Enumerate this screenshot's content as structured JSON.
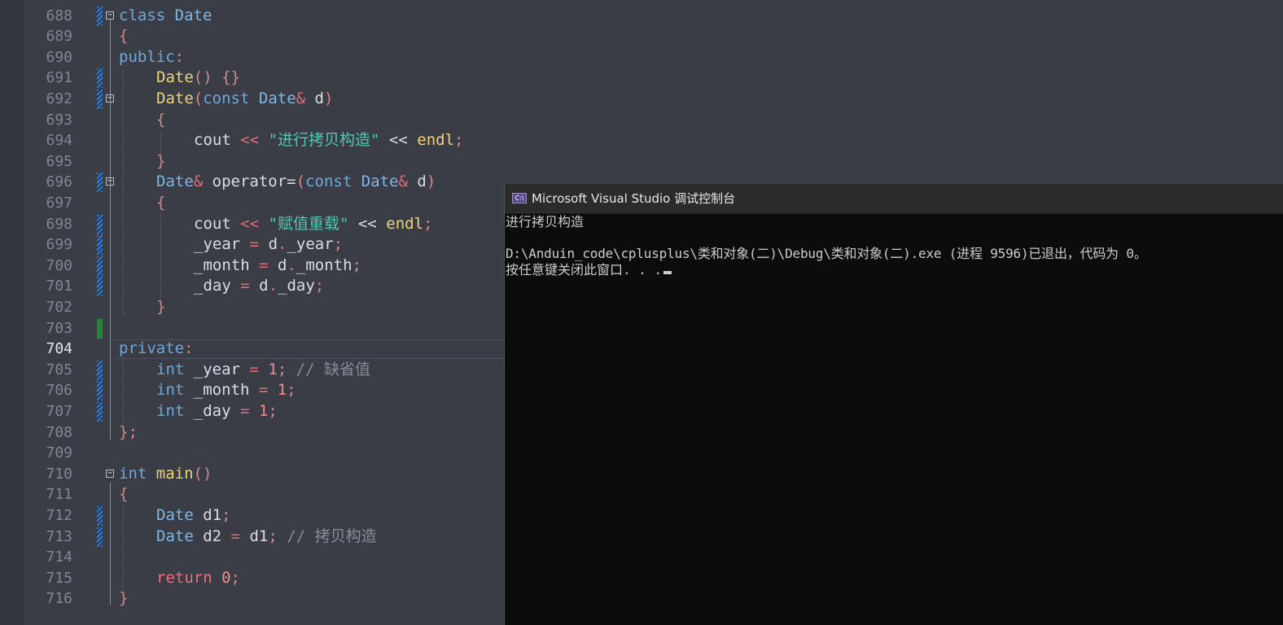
{
  "editor": {
    "current_line": "704",
    "lines": [
      {
        "num": "688"
      },
      {
        "num": "689"
      },
      {
        "num": "690"
      },
      {
        "num": "691"
      },
      {
        "num": "692"
      },
      {
        "num": "693"
      },
      {
        "num": "694"
      },
      {
        "num": "695"
      },
      {
        "num": "696"
      },
      {
        "num": "697"
      },
      {
        "num": "698"
      },
      {
        "num": "699"
      },
      {
        "num": "700"
      },
      {
        "num": "701"
      },
      {
        "num": "702"
      },
      {
        "num": "703"
      },
      {
        "num": "704"
      },
      {
        "num": "705"
      },
      {
        "num": "706"
      },
      {
        "num": "707"
      },
      {
        "num": "708"
      },
      {
        "num": "709"
      },
      {
        "num": "710"
      },
      {
        "num": "711"
      },
      {
        "num": "712"
      },
      {
        "num": "713"
      },
      {
        "num": "714"
      },
      {
        "num": "715"
      },
      {
        "num": "716"
      }
    ],
    "code": {
      "l688_kw": "class",
      "l688_name": "Date",
      "l689": "{",
      "l690_kw": "public",
      "l690_colon": ":",
      "l691_fn": "Date",
      "l691_rest": "() {}",
      "l692_fn": "Date",
      "l692_p1": "(",
      "l692_const": "const",
      "l692_type": "Date",
      "l692_amp": "&",
      "l692_param": " d",
      "l692_p2": ")",
      "l693": "{",
      "l694_cout": "cout",
      "l694_op1": "<<",
      "l694_str": "\"进行拷贝构造\"",
      "l694_op2": "<<",
      "l694_endl": "endl",
      "l694_semi": ";",
      "l695": "}",
      "l696_type": "Date",
      "l696_amp": "&",
      "l696_op": " operator=",
      "l696_p1": "(",
      "l696_const": "const",
      "l696_type2": "Date",
      "l696_amp2": "&",
      "l696_param": " d",
      "l696_p2": ")",
      "l697": "{",
      "l698_cout": "cout",
      "l698_op1": "<<",
      "l698_str": "\"赋值重载\"",
      "l698_op2": "<<",
      "l698_endl": "endl",
      "l698_semi": ";",
      "l699_lhs": "_year",
      "l699_eq": "=",
      "l699_d": "d",
      "l699_dot": ".",
      "l699_rhs": "_year",
      "l699_semi": ";",
      "l700_lhs": "_month",
      "l700_eq": "=",
      "l700_d": "d",
      "l700_dot": ".",
      "l700_rhs": "_month",
      "l700_semi": ";",
      "l701_lhs": "_day",
      "l701_eq": "=",
      "l701_d": "d",
      "l701_dot": ".",
      "l701_rhs": "_day",
      "l701_semi": ";",
      "l702": "}",
      "l704_kw": "private",
      "l704_colon": ":",
      "l705_kw": "int",
      "l705_var": " _year",
      "l705_eq": "=",
      "l705_num": "1",
      "l705_semi": ";",
      "l705_cm": "// 缺省值",
      "l706_kw": "int",
      "l706_var": " _month",
      "l706_eq": "=",
      "l706_num": "1",
      "l706_semi": ";",
      "l707_kw": "int",
      "l707_var": " _day",
      "l707_eq": "=",
      "l707_num": "1",
      "l707_semi": ";",
      "l708": "};",
      "l710_kw": "int",
      "l710_fn": " main",
      "l710_paren": "()",
      "l711": "{",
      "l712_type": "Date",
      "l712_var": " d1",
      "l712_semi": ";",
      "l713_type": "Date",
      "l713_var": " d2",
      "l713_eq": "=",
      "l713_rhs": "d1",
      "l713_semi": ";",
      "l713_cm": "// 拷贝构造",
      "l715_kw": "return",
      "l715_num": "0",
      "l715_semi": ";",
      "l716": "}"
    }
  },
  "console": {
    "title": "Microsoft Visual Studio 调试控制台",
    "icon": "C:\\",
    "lines": [
      "进行拷贝构造",
      "",
      "D:\\Anduin_code\\cplusplus\\类和对象(二)\\Debug\\类和对象(二).exe (进程 9596)已退出，代码为 0。",
      "按任意键关闭此窗口. . ."
    ]
  }
}
